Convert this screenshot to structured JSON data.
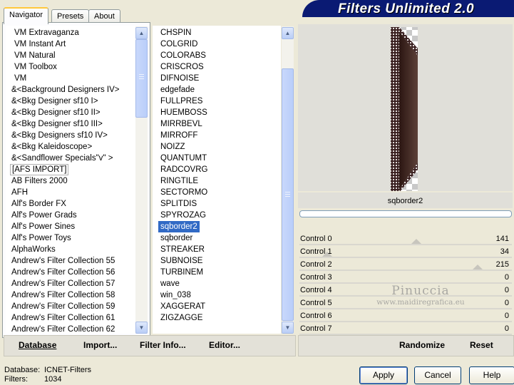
{
  "title": "Filters Unlimited 2.0",
  "tabs": {
    "navigator": "Navigator",
    "presets": "Presets",
    "about": "About"
  },
  "categories": [
    "VM Extravaganza",
    "VM Instant Art",
    "VM Natural",
    "VM Toolbox",
    "VM",
    "&<Background Designers IV>",
    "&<Bkg Designer sf10 I>",
    "&<Bkg Designer sf10 II>",
    "&<Bkg Designer sf10 III>",
    "&<Bkg Designers sf10 IV>",
    "&<Bkg Kaleidoscope>",
    "&<Sandflower Specials\"v\" >",
    "[AFS IMPORT]",
    "AB Filters 2000",
    "AFH",
    "Alf's Border FX",
    "Alf's Power Grads",
    "Alf's Power Sines",
    "Alf's Power Toys",
    "AlphaWorks",
    "Andrew's Filter Collection 55",
    "Andrew's Filter Collection 56",
    "Andrew's Filter Collection 57",
    "Andrew's Filter Collection 58",
    "Andrew's Filter Collection 59",
    "Andrew's Filter Collection 61",
    "Andrew's Filter Collection 62"
  ],
  "filters": [
    "CHSPIN",
    "COLGRID",
    "COLORABS",
    "CRISCROS",
    "DIFNOISE",
    "edgefade",
    "FULLPRES",
    "HUEMBOSS",
    "MIRRBEVL",
    "MIRROFF",
    "NOIZZ",
    "QUANTUMT",
    "RADCOVRG",
    "RINGTILE",
    "SECTORMO",
    "SPLITDIS",
    "SPYROZAG",
    "sqborder2",
    "sqborder",
    "STREAKER",
    "SUBNOISE",
    "TURBINEM",
    "wave",
    "win_038",
    "XAGGERAT",
    "ZIGZAGGE"
  ],
  "selected_filter": "sqborder2",
  "preview_caption": "sqborder2",
  "progress": 0,
  "controls": [
    {
      "label": "Control 0",
      "value": "141"
    },
    {
      "label": "Control 1",
      "value": "34"
    },
    {
      "label": "Control 2",
      "value": "215"
    },
    {
      "label": "Control 3",
      "value": "0"
    },
    {
      "label": "Control 4",
      "value": "0"
    },
    {
      "label": "Control 5",
      "value": "0"
    },
    {
      "label": "Control 6",
      "value": "0"
    },
    {
      "label": "Control 7",
      "value": "0"
    }
  ],
  "control_levels": [
    0.55,
    0.13,
    0.84,
    0,
    0,
    0,
    0,
    0
  ],
  "watermark": {
    "line1": "Pinuccia",
    "line2": "www.maidiregrafica.eu"
  },
  "toolbar": {
    "database": "Database",
    "import": "Import...",
    "filter_info": "Filter Info...",
    "editor": "Editor..."
  },
  "right_toolbar": {
    "randomize": "Randomize",
    "reset": "Reset"
  },
  "status": {
    "database_label": "Database:",
    "database_value": "ICNET-Filters",
    "filters_label": "Filters:",
    "filters_value": "1034"
  },
  "buttons": {
    "apply": "Apply",
    "cancel": "Cancel",
    "help": "Help"
  },
  "colors": {
    "banner": "#0a1a73",
    "selection": "#316ac5",
    "tab_highlight": "#ffc83c"
  },
  "icons": [
    "scroll-up-icon",
    "scroll-down-icon"
  ]
}
